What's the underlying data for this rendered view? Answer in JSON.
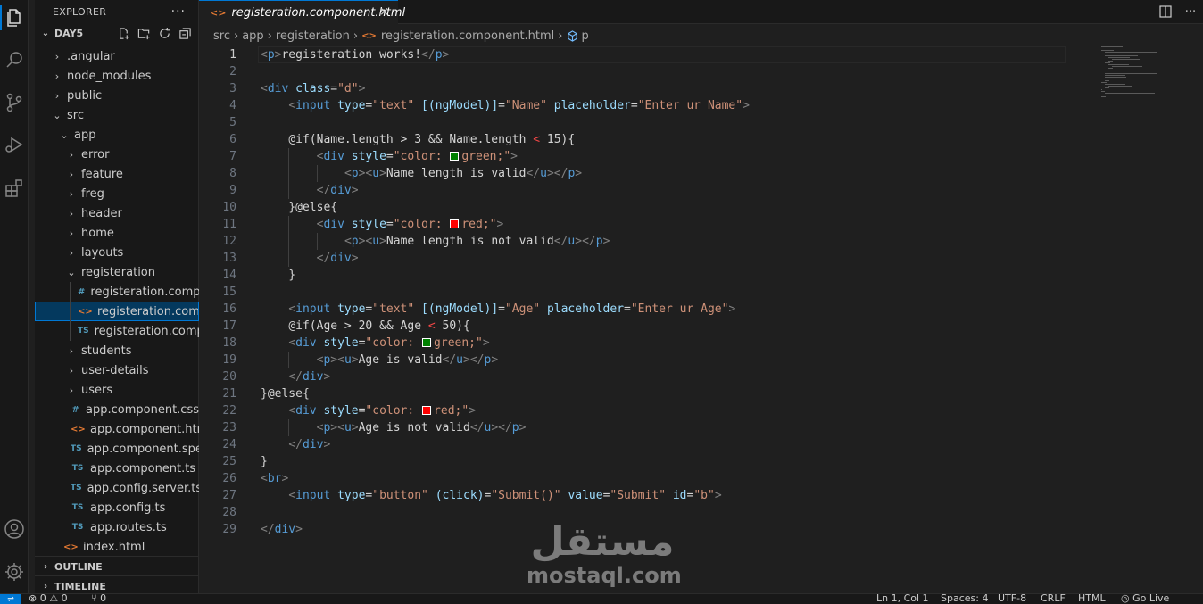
{
  "explorer": {
    "title": "EXPLORER",
    "more": "···",
    "workspace": "DAY5",
    "items": [
      {
        "label": ".angular",
        "kind": "folder",
        "depth": 1,
        "open": false
      },
      {
        "label": "node_modules",
        "kind": "folder",
        "depth": 1,
        "open": false
      },
      {
        "label": "public",
        "kind": "folder",
        "depth": 1,
        "open": false
      },
      {
        "label": "src",
        "kind": "folder",
        "depth": 1,
        "open": true
      },
      {
        "label": "app",
        "kind": "folder",
        "depth": 2,
        "open": true
      },
      {
        "label": "error",
        "kind": "folder",
        "depth": 3,
        "open": false
      },
      {
        "label": "feature",
        "kind": "folder",
        "depth": 3,
        "open": false
      },
      {
        "label": "freg",
        "kind": "folder",
        "depth": 3,
        "open": false
      },
      {
        "label": "header",
        "kind": "folder",
        "depth": 3,
        "open": false
      },
      {
        "label": "home",
        "kind": "folder",
        "depth": 3,
        "open": false
      },
      {
        "label": "layouts",
        "kind": "folder",
        "depth": 3,
        "open": false
      },
      {
        "label": "registeration",
        "kind": "folder",
        "depth": 3,
        "open": true
      },
      {
        "label": "registeration.compo...",
        "kind": "css",
        "depth": 4
      },
      {
        "label": "registeration.compo...",
        "kind": "html",
        "depth": 4,
        "selected": true
      },
      {
        "label": "registeration.compo...",
        "kind": "ts",
        "depth": 4
      },
      {
        "label": "students",
        "kind": "folder",
        "depth": 3,
        "open": false
      },
      {
        "label": "user-details",
        "kind": "folder",
        "depth": 3,
        "open": false
      },
      {
        "label": "users",
        "kind": "folder",
        "depth": 3,
        "open": false
      },
      {
        "label": "app.component.css",
        "kind": "css",
        "depth": 3
      },
      {
        "label": "app.component.html",
        "kind": "html",
        "depth": 3
      },
      {
        "label": "app.component.spec.ts",
        "kind": "ts",
        "depth": 3
      },
      {
        "label": "app.component.ts",
        "kind": "ts",
        "depth": 3
      },
      {
        "label": "app.config.server.ts",
        "kind": "ts",
        "depth": 3
      },
      {
        "label": "app.config.ts",
        "kind": "ts",
        "depth": 3
      },
      {
        "label": "app.routes.ts",
        "kind": "ts",
        "depth": 3
      },
      {
        "label": "index.html",
        "kind": "html",
        "depth": 2
      }
    ],
    "outline": "OUTLINE",
    "timeline": "TIMELINE"
  },
  "icons": {
    "css": "#",
    "html": "<>",
    "ts": "TS",
    "chevron_right": "›",
    "chevron_down": "⌄"
  },
  "tab": {
    "label": "registeration.component.html",
    "close": "×"
  },
  "breadcrumb": {
    "parts": [
      "src",
      "app",
      "registeration",
      "registeration.component.html",
      "p"
    ],
    "sep": "›"
  },
  "status": {
    "problems": "⊗ 0  ⚠ 0",
    "ports": "⑂ 0",
    "cursor": "Ln 1, Col 1",
    "spaces": "Spaces: 4",
    "encoding": "UTF-8",
    "eol": "CRLF",
    "language": "HTML",
    "golive": "Go Live"
  },
  "watermark": {
    "arabic": "مستقل",
    "latin": "mostaql.com"
  },
  "colors": {
    "accent": "#0078d4",
    "swatch_green": "#008000",
    "swatch_red": "#ff0000"
  },
  "code": {
    "current_line": 1,
    "lines": [
      {
        "n": "1",
        "indent": 0,
        "tokens": [
          [
            "t-br",
            "<"
          ],
          [
            "t-tag",
            "p"
          ],
          [
            "t-br",
            ">"
          ],
          [
            "t-txt",
            "registeration works!"
          ],
          [
            "t-br",
            "</"
          ],
          [
            "t-tag",
            "p"
          ],
          [
            "t-br",
            ">"
          ]
        ]
      },
      {
        "n": "2",
        "indent": 0,
        "tokens": []
      },
      {
        "n": "3",
        "indent": 0,
        "tokens": [
          [
            "t-br",
            "<"
          ],
          [
            "t-tag",
            "div"
          ],
          [
            "t-txt",
            " "
          ],
          [
            "t-attr",
            "class"
          ],
          [
            "t-txt",
            "="
          ],
          [
            "t-str",
            "\"d\""
          ],
          [
            "t-br",
            ">"
          ]
        ]
      },
      {
        "n": "4",
        "indent": 1,
        "tokens": [
          [
            "t-br",
            "<"
          ],
          [
            "t-tag",
            "input"
          ],
          [
            "t-txt",
            " "
          ],
          [
            "t-attr",
            "type"
          ],
          [
            "t-txt",
            "="
          ],
          [
            "t-str",
            "\"text\""
          ],
          [
            "t-txt",
            " "
          ],
          [
            "t-attr",
            "[(ngModel)]"
          ],
          [
            "t-txt",
            "="
          ],
          [
            "t-str",
            "\"Name\""
          ],
          [
            "t-txt",
            " "
          ],
          [
            "t-attr",
            "placeholder"
          ],
          [
            "t-txt",
            "="
          ],
          [
            "t-str",
            "\"Enter ur Name\""
          ],
          [
            "t-br",
            ">"
          ]
        ]
      },
      {
        "n": "5",
        "indent": 0,
        "tokens": []
      },
      {
        "n": "6",
        "indent": 1,
        "tokens": [
          [
            "t-ctl",
            "@if(Name.length > 3 && Name.length "
          ],
          [
            "t-lt",
            "<"
          ],
          [
            "t-ctl",
            " 15){"
          ]
        ]
      },
      {
        "n": "7",
        "indent": 2,
        "tokens": [
          [
            "t-br",
            "<"
          ],
          [
            "t-tag",
            "div"
          ],
          [
            "t-txt",
            " "
          ],
          [
            "t-attr",
            "style"
          ],
          [
            "t-txt",
            "="
          ],
          [
            "t-str",
            "\"color: "
          ],
          [
            "swatch-green",
            ""
          ],
          [
            "t-str",
            "green;\""
          ],
          [
            "t-br",
            ">"
          ]
        ]
      },
      {
        "n": "8",
        "indent": 3,
        "tokens": [
          [
            "t-br",
            "<"
          ],
          [
            "t-tag",
            "p"
          ],
          [
            "t-br",
            "><"
          ],
          [
            "t-tag",
            "u"
          ],
          [
            "t-br",
            ">"
          ],
          [
            "t-txt",
            "Name length is valid"
          ],
          [
            "t-br",
            "</"
          ],
          [
            "t-tag",
            "u"
          ],
          [
            "t-br",
            "></"
          ],
          [
            "t-tag",
            "p"
          ],
          [
            "t-br",
            ">"
          ]
        ]
      },
      {
        "n": "9",
        "indent": 2,
        "tokens": [
          [
            "t-br",
            "</"
          ],
          [
            "t-tag",
            "div"
          ],
          [
            "t-br",
            ">"
          ]
        ]
      },
      {
        "n": "10",
        "indent": 1,
        "tokens": [
          [
            "t-ctl",
            "}@else{"
          ]
        ]
      },
      {
        "n": "11",
        "indent": 2,
        "tokens": [
          [
            "t-br",
            "<"
          ],
          [
            "t-tag",
            "div"
          ],
          [
            "t-txt",
            " "
          ],
          [
            "t-attr",
            "style"
          ],
          [
            "t-txt",
            "="
          ],
          [
            "t-str",
            "\"color: "
          ],
          [
            "swatch-red",
            ""
          ],
          [
            "t-str",
            "red;\""
          ],
          [
            "t-br",
            ">"
          ]
        ]
      },
      {
        "n": "12",
        "indent": 3,
        "tokens": [
          [
            "t-br",
            "<"
          ],
          [
            "t-tag",
            "p"
          ],
          [
            "t-br",
            "><"
          ],
          [
            "t-tag",
            "u"
          ],
          [
            "t-br",
            ">"
          ],
          [
            "t-txt",
            "Name length is not valid"
          ],
          [
            "t-br",
            "</"
          ],
          [
            "t-tag",
            "u"
          ],
          [
            "t-br",
            "></"
          ],
          [
            "t-tag",
            "p"
          ],
          [
            "t-br",
            ">"
          ]
        ]
      },
      {
        "n": "13",
        "indent": 2,
        "tokens": [
          [
            "t-br",
            "</"
          ],
          [
            "t-tag",
            "div"
          ],
          [
            "t-br",
            ">"
          ]
        ]
      },
      {
        "n": "14",
        "indent": 1,
        "tokens": [
          [
            "t-ctl",
            "}"
          ]
        ]
      },
      {
        "n": "15",
        "indent": 0,
        "tokens": []
      },
      {
        "n": "16",
        "indent": 1,
        "tokens": [
          [
            "t-br",
            "<"
          ],
          [
            "t-tag",
            "input"
          ],
          [
            "t-txt",
            " "
          ],
          [
            "t-attr",
            "type"
          ],
          [
            "t-txt",
            "="
          ],
          [
            "t-str",
            "\"text\""
          ],
          [
            "t-txt",
            " "
          ],
          [
            "t-attr",
            "[(ngModel)]"
          ],
          [
            "t-txt",
            "="
          ],
          [
            "t-str",
            "\"Age\""
          ],
          [
            "t-txt",
            " "
          ],
          [
            "t-attr",
            "placeholder"
          ],
          [
            "t-txt",
            "="
          ],
          [
            "t-str",
            "\"Enter ur Age\""
          ],
          [
            "t-br",
            ">"
          ]
        ]
      },
      {
        "n": "17",
        "indent": 1,
        "tokens": [
          [
            "t-ctl",
            "@if(Age > 20 && Age "
          ],
          [
            "t-lt",
            "<"
          ],
          [
            "t-ctl",
            " 50){"
          ]
        ]
      },
      {
        "n": "18",
        "indent": 1,
        "tokens": [
          [
            "t-br",
            "<"
          ],
          [
            "t-tag",
            "div"
          ],
          [
            "t-txt",
            " "
          ],
          [
            "t-attr",
            "style"
          ],
          [
            "t-txt",
            "="
          ],
          [
            "t-str",
            "\"color: "
          ],
          [
            "swatch-green",
            ""
          ],
          [
            "t-str",
            "green;\""
          ],
          [
            "t-br",
            ">"
          ]
        ]
      },
      {
        "n": "19",
        "indent": 2,
        "tokens": [
          [
            "t-br",
            "<"
          ],
          [
            "t-tag",
            "p"
          ],
          [
            "t-br",
            "><"
          ],
          [
            "t-tag",
            "u"
          ],
          [
            "t-br",
            ">"
          ],
          [
            "t-txt",
            "Age is valid"
          ],
          [
            "t-br",
            "</"
          ],
          [
            "t-tag",
            "u"
          ],
          [
            "t-br",
            "></"
          ],
          [
            "t-tag",
            "p"
          ],
          [
            "t-br",
            ">"
          ]
        ]
      },
      {
        "n": "20",
        "indent": 1,
        "tokens": [
          [
            "t-br",
            "</"
          ],
          [
            "t-tag",
            "div"
          ],
          [
            "t-br",
            ">"
          ]
        ]
      },
      {
        "n": "21",
        "indent": 0,
        "tokens": [
          [
            "t-ctl",
            "}@else{"
          ]
        ]
      },
      {
        "n": "22",
        "indent": 1,
        "tokens": [
          [
            "t-br",
            "<"
          ],
          [
            "t-tag",
            "div"
          ],
          [
            "t-txt",
            " "
          ],
          [
            "t-attr",
            "style"
          ],
          [
            "t-txt",
            "="
          ],
          [
            "t-str",
            "\"color: "
          ],
          [
            "swatch-red",
            ""
          ],
          [
            "t-str",
            "red;\""
          ],
          [
            "t-br",
            ">"
          ]
        ]
      },
      {
        "n": "23",
        "indent": 2,
        "tokens": [
          [
            "t-br",
            "<"
          ],
          [
            "t-tag",
            "p"
          ],
          [
            "t-br",
            "><"
          ],
          [
            "t-tag",
            "u"
          ],
          [
            "t-br",
            ">"
          ],
          [
            "t-txt",
            "Age is not valid"
          ],
          [
            "t-br",
            "</"
          ],
          [
            "t-tag",
            "u"
          ],
          [
            "t-br",
            "></"
          ],
          [
            "t-tag",
            "p"
          ],
          [
            "t-br",
            ">"
          ]
        ]
      },
      {
        "n": "24",
        "indent": 1,
        "tokens": [
          [
            "t-br",
            "</"
          ],
          [
            "t-tag",
            "div"
          ],
          [
            "t-br",
            ">"
          ]
        ]
      },
      {
        "n": "25",
        "indent": 0,
        "tokens": [
          [
            "t-ctl",
            "}"
          ]
        ]
      },
      {
        "n": "26",
        "indent": 0,
        "tokens": [
          [
            "t-br",
            "<"
          ],
          [
            "t-tag",
            "br"
          ],
          [
            "t-br",
            ">"
          ]
        ]
      },
      {
        "n": "27",
        "indent": 1,
        "tokens": [
          [
            "t-br",
            "<"
          ],
          [
            "t-tag",
            "input"
          ],
          [
            "t-txt",
            " "
          ],
          [
            "t-attr",
            "type"
          ],
          [
            "t-txt",
            "="
          ],
          [
            "t-str",
            "\"button\""
          ],
          [
            "t-txt",
            " "
          ],
          [
            "t-attr",
            "(click)"
          ],
          [
            "t-txt",
            "="
          ],
          [
            "t-str",
            "\"Submit()\""
          ],
          [
            "t-txt",
            " "
          ],
          [
            "t-attr",
            "value"
          ],
          [
            "t-txt",
            "="
          ],
          [
            "t-str",
            "\"Submit\""
          ],
          [
            "t-txt",
            " "
          ],
          [
            "t-attr",
            "id"
          ],
          [
            "t-txt",
            "="
          ],
          [
            "t-str",
            "\"b\""
          ],
          [
            "t-br",
            ">"
          ]
        ]
      },
      {
        "n": "28",
        "indent": 0,
        "tokens": []
      },
      {
        "n": "29",
        "indent": 0,
        "tokens": [
          [
            "t-br",
            "</"
          ],
          [
            "t-tag",
            "div"
          ],
          [
            "t-br",
            ">"
          ]
        ]
      }
    ]
  }
}
